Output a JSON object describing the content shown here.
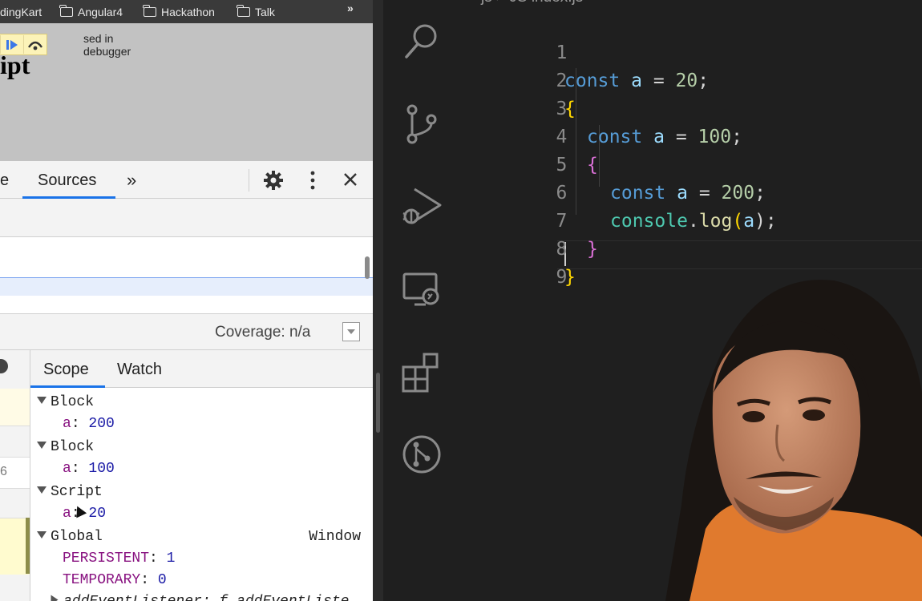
{
  "bookmarks": {
    "items": [
      {
        "label": "dingKart",
        "folder": false
      },
      {
        "label": "Angular4",
        "folder": true
      },
      {
        "label": "Hackathon",
        "folder": true
      },
      {
        "label": "Talk",
        "folder": true
      }
    ],
    "overflow": "»"
  },
  "page": {
    "paused_text": "sed in debugger",
    "title_fragment": "ipt"
  },
  "devtools": {
    "tabs": {
      "previous": "e",
      "active": "Sources",
      "more": "»"
    },
    "coverage": "Coverage: n/a",
    "gutter_line_fragment": "6",
    "scope_tabs": {
      "scope": "Scope",
      "watch": "Watch"
    },
    "scope": [
      {
        "header": "Block",
        "vars": [
          {
            "key": "a",
            "value": "200"
          }
        ]
      },
      {
        "header": "Block",
        "vars": [
          {
            "key": "a",
            "value": "100"
          }
        ]
      },
      {
        "header": "Script",
        "vars": [
          {
            "key": "a",
            "value": "20"
          }
        ]
      },
      {
        "header": "Global",
        "extra": "Window",
        "vars": [
          {
            "key": "PERSISTENT",
            "value": "1"
          },
          {
            "key": "TEMPORARY",
            "value": "0"
          }
        ]
      }
    ],
    "scope_cutoff": "addEventListener: f addEventListe"
  },
  "vscode": {
    "breadcrumb": "js  >  JS  index.js",
    "line_numbers": [
      "1",
      "2",
      "3",
      "4",
      "5",
      "6",
      "7",
      "8",
      "9"
    ],
    "code": {
      "l1": {
        "kw": "const",
        "var": "a",
        "eq": " = ",
        "num": "20",
        "end": ";"
      },
      "l2": "{",
      "l3": {
        "kw": "const",
        "var": "a",
        "eq": " = ",
        "num": "100",
        "end": ";"
      },
      "l4": "{",
      "l5": {
        "kw": "const",
        "var": "a",
        "eq": " = ",
        "num": "200",
        "end": ";"
      },
      "l6": {
        "obj": "console",
        "dot": ".",
        "fn": "log",
        "open": "(",
        "arg": "a",
        "close": ");"
      },
      "l7": "}",
      "l8": "}"
    }
  },
  "colors": {
    "devtools_accent": "#1a73e8",
    "vscode_keyword": "#569cd6",
    "vscode_number": "#b5cea8",
    "vscode_bracket_l1": "#ffd700",
    "vscode_bracket_l2": "#da70d6"
  }
}
